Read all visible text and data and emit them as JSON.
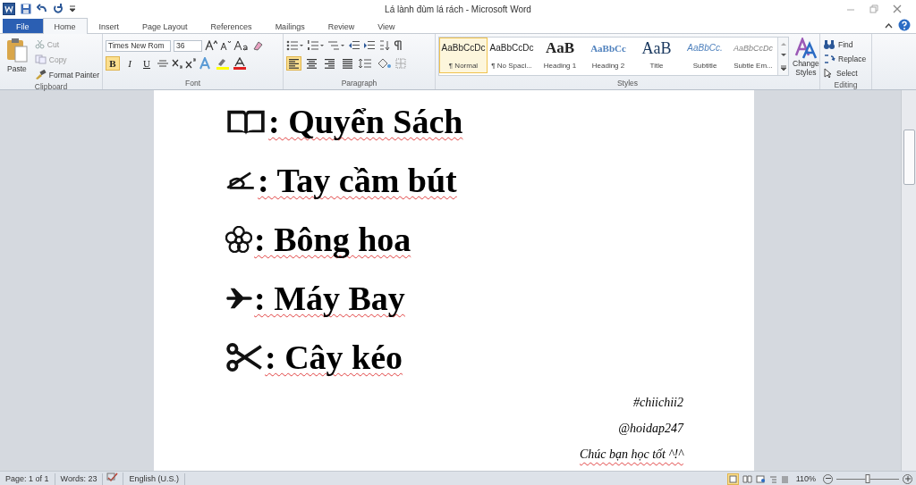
{
  "window": {
    "title": "Lá lành đùm lá rách  -  Microsoft Word"
  },
  "tabs": [
    {
      "label": "File",
      "kind": "file",
      "selected": false
    },
    {
      "label": "Home",
      "kind": "tab",
      "selected": true
    },
    {
      "label": "Insert",
      "kind": "tab",
      "selected": false
    },
    {
      "label": "Page Layout",
      "kind": "tab",
      "selected": false
    },
    {
      "label": "References",
      "kind": "tab",
      "selected": false
    },
    {
      "label": "Mailings",
      "kind": "tab",
      "selected": false
    },
    {
      "label": "Review",
      "kind": "tab",
      "selected": false
    },
    {
      "label": "View",
      "kind": "tab",
      "selected": false
    }
  ],
  "clipboard": {
    "title": "Clipboard",
    "paste": "Paste",
    "items": [
      {
        "label": "Cut",
        "kind": "cut",
        "disabled": true
      },
      {
        "label": "Copy",
        "kind": "copy",
        "disabled": true
      },
      {
        "label": "Format Painter",
        "kind": "painter",
        "disabled": false
      }
    ]
  },
  "font": {
    "title": "Font",
    "font_name": "Times New Rom",
    "font_size": "36",
    "styles": [
      {
        "label": "B",
        "kind": "bold",
        "selected": true
      },
      {
        "label": "I",
        "kind": "italic",
        "selected": false
      },
      {
        "label": "U",
        "kind": "underline",
        "selected": false
      }
    ]
  },
  "paragraph": {
    "title": "Paragraph",
    "align": [
      {
        "kind": "left",
        "selected": true
      },
      {
        "kind": "center",
        "selected": false
      },
      {
        "kind": "right",
        "selected": false
      },
      {
        "kind": "justify",
        "selected": false
      }
    ]
  },
  "styles": {
    "title": "Styles",
    "items": [
      {
        "preview": "AaBbCcDc",
        "label": "¶ Normal",
        "kind": "normal",
        "selected": true
      },
      {
        "preview": "AaBbCcDc",
        "label": "¶ No Spaci...",
        "kind": "normal",
        "selected": false
      },
      {
        "preview": "AaB",
        "label": "Heading 1",
        "kind": "heading1",
        "selected": false
      },
      {
        "preview": "AaBbCc",
        "label": "Heading 2",
        "kind": "heading2",
        "selected": false
      },
      {
        "preview": "AaB",
        "label": "Title",
        "kind": "title",
        "selected": false
      },
      {
        "preview": "AaBbCc.",
        "label": "Subtitle",
        "kind": "subtitle",
        "selected": false
      },
      {
        "preview": "AaBbCcDc",
        "label": "Subtle Em...",
        "kind": "subtle",
        "selected": false
      }
    ],
    "change_styles": [
      "Change",
      "Styles"
    ]
  },
  "editing": {
    "title": "Editing",
    "items": [
      {
        "label": "Find",
        "kind": "find"
      },
      {
        "label": "Replace",
        "kind": "replace"
      },
      {
        "label": "Select",
        "kind": "select"
      }
    ]
  },
  "document": {
    "lines": [
      {
        "kind": "book",
        "text": ": Quyển Sách"
      },
      {
        "kind": "pen",
        "text": ": Tay cầm bút"
      },
      {
        "kind": "flower",
        "text": ": Bông hoa"
      },
      {
        "kind": "plane",
        "text": ": Máy Bay"
      },
      {
        "kind": "scissors",
        "text": ": Cây kéo"
      }
    ],
    "signature": [
      "#chiichii2",
      "@hoidap247",
      "Chúc bạn học tốt ^!^"
    ]
  },
  "status_bar": {
    "page": "Page: 1 of 1",
    "words": "Words: 23",
    "language": "English (U.S.)",
    "zoom": "110%",
    "zoom_level": {
      "level": 0.5
    }
  }
}
